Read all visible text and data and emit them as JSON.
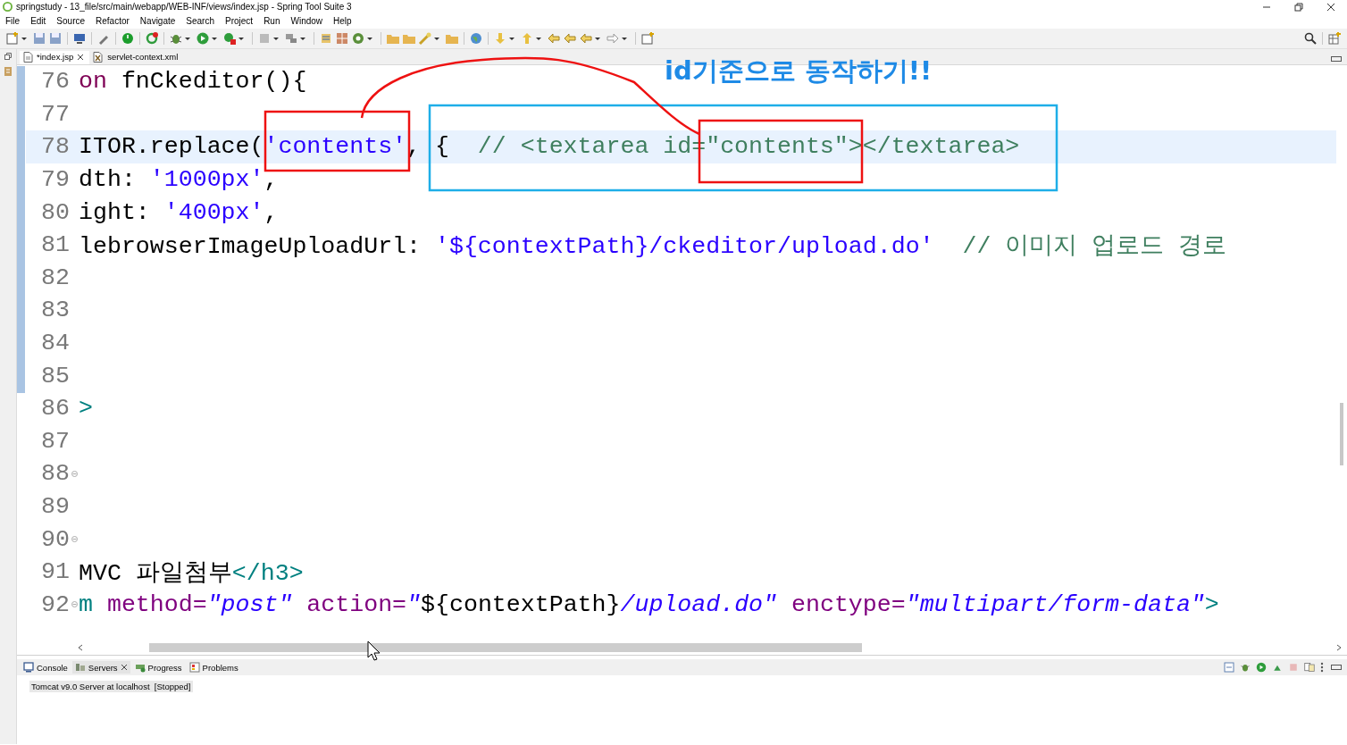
{
  "window": {
    "title": "springstudy - 13_file/src/main/webapp/WEB-INF/views/index.jsp - Spring Tool Suite 3"
  },
  "menu": [
    "File",
    "Edit",
    "Source",
    "Refactor",
    "Navigate",
    "Search",
    "Project",
    "Run",
    "Window",
    "Help"
  ],
  "editor_tabs": [
    {
      "label": "*index.jsp",
      "kind": "jsp",
      "selected": true
    },
    {
      "label": "servlet-context.xml",
      "kind": "xml",
      "selected": false
    }
  ],
  "code_lines": [
    {
      "number": "76",
      "fold": false,
      "current": false,
      "tokens": [
        {
          "kind": "keyword",
          "text": "on"
        },
        {
          "kind": "plain",
          "text": " fnCkeditor(){"
        }
      ]
    },
    {
      "number": "77",
      "fold": false,
      "current": false
    },
    {
      "number": "78",
      "fold": false,
      "current": true,
      "tokens": [
        {
          "kind": "plain",
          "text": "ITOR.replace("
        },
        {
          "kind": "string",
          "text": "'contents'"
        },
        {
          "kind": "plain",
          "text": ", {  "
        },
        {
          "kind": "comment",
          "text": "// <textarea id=\"contents\"></textarea>"
        }
      ]
    },
    {
      "number": "79",
      "fold": false,
      "current": false,
      "tokens": [
        {
          "kind": "plain",
          "text": "dth: "
        },
        {
          "kind": "string",
          "text": "'1000px'"
        },
        {
          "kind": "plain",
          "text": ","
        }
      ]
    },
    {
      "number": "80",
      "fold": false,
      "current": false,
      "tokens": [
        {
          "kind": "plain",
          "text": "ight: "
        },
        {
          "kind": "string",
          "text": "'400px'"
        },
        {
          "kind": "plain",
          "text": ","
        }
      ]
    },
    {
      "number": "81",
      "fold": false,
      "current": false,
      "tokens": [
        {
          "kind": "plain",
          "text": "lebrowserImageUploadUrl: "
        },
        {
          "kind": "string",
          "text": "'${contextPath}/ckeditor/upload.do'"
        },
        {
          "kind": "comment",
          "text": "  // 이미지 업로드 경로"
        }
      ]
    },
    {
      "number": "82",
      "fold": false,
      "current": false
    },
    {
      "number": "83",
      "fold": false,
      "current": false
    },
    {
      "number": "84",
      "fold": false,
      "current": false
    },
    {
      "number": "85",
      "fold": false,
      "current": false
    },
    {
      "number": "86",
      "fold": false,
      "current": false,
      "tokens": [
        {
          "kind": "tag",
          "text": ">"
        }
      ]
    },
    {
      "number": "87",
      "fold": false,
      "current": false
    },
    {
      "number": "88",
      "fold": true,
      "current": false
    },
    {
      "number": "89",
      "fold": false,
      "current": false
    },
    {
      "number": "90",
      "fold": true,
      "current": false
    },
    {
      "number": "91",
      "fold": false,
      "current": false,
      "tokens": [
        {
          "kind": "plain",
          "text": "MVC 파일첨부"
        },
        {
          "kind": "tag",
          "text": "</h3>"
        }
      ]
    },
    {
      "number": "92",
      "fold": true,
      "current": false,
      "tokens": [
        {
          "kind": "tag",
          "text": "m "
        },
        {
          "kind": "attr",
          "text": "method="
        },
        {
          "kind": "istring",
          "text": "\"post\" "
        },
        {
          "kind": "attr",
          "text": "action="
        },
        {
          "kind": "istring",
          "text": "\""
        },
        {
          "kind": "plain",
          "text": "${contextPath}"
        },
        {
          "kind": "istring",
          "text": "/upload.do\" "
        },
        {
          "kind": "attr",
          "text": "enctype="
        },
        {
          "kind": "istring",
          "text": "\"multipart/form-data\""
        },
        {
          "kind": "tag",
          "text": ">"
        }
      ]
    }
  ],
  "annotation": {
    "text": "id기준으로 동작하기!!"
  },
  "bottom_tabs": [
    {
      "label": "Console",
      "kind": "console",
      "selected": false
    },
    {
      "label": "Servers",
      "kind": "servers",
      "selected": true
    },
    {
      "label": "Progress",
      "kind": "progress",
      "selected": false
    },
    {
      "label": "Problems",
      "kind": "problems",
      "selected": false
    }
  ],
  "servers": [
    {
      "name": "Tomcat v9.0 Server at localhost",
      "status": "[Stopped]",
      "selected": true
    }
  ]
}
